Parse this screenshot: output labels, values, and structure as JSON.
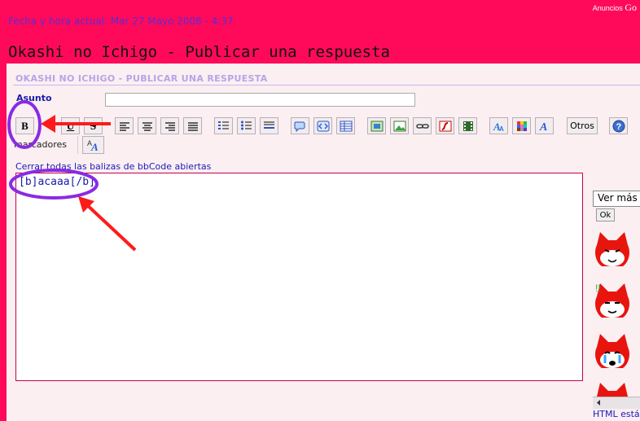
{
  "header": {
    "ads_label": "Anuncios",
    "ads_brand": "Go",
    "datetime": "Fecha y hora actual: Mar 27 Mayo 2008 - 4:37",
    "page_title": "Okashi no Ichigo - Publicar una respuesta"
  },
  "form": {
    "panel_heading": "OKASHI NO ICHIGO - PUBLICAR UNA RESPUESTA",
    "subject_label": "Asunto",
    "subject_value": "",
    "markers_label": "marcadores",
    "close_tags_link": "Cerrar todas las balizas de bbCode abiertas",
    "message_text": "[b]acaaa[/b]"
  },
  "toolbar": {
    "bold": "B",
    "underline": "U",
    "strike": "S",
    "others": "Otros",
    "icons": [
      "bold-icon",
      "underline-icon",
      "strike-icon",
      "align-left-icon",
      "align-center-icon",
      "align-right-icon",
      "justify-icon",
      "ordered-list-icon",
      "unordered-list-icon",
      "horizontal-rule-icon",
      "quote-icon",
      "code-icon",
      "table-icon",
      "image-icon",
      "picture-icon",
      "link-icon",
      "flash-icon",
      "video-icon",
      "font-color-icon",
      "color-grid-icon",
      "font-face-icon",
      "help-icon",
      "font-size-icon"
    ]
  },
  "sidebar": {
    "ver_mas": "Ver más",
    "ok": "Ok",
    "status": "HTML está"
  },
  "colors": {
    "header_bg": "#ff0a5a",
    "annotation_circle": "#8a2be2",
    "annotation_arrow": "#ff1a1a",
    "link": "#1a1ab8"
  }
}
